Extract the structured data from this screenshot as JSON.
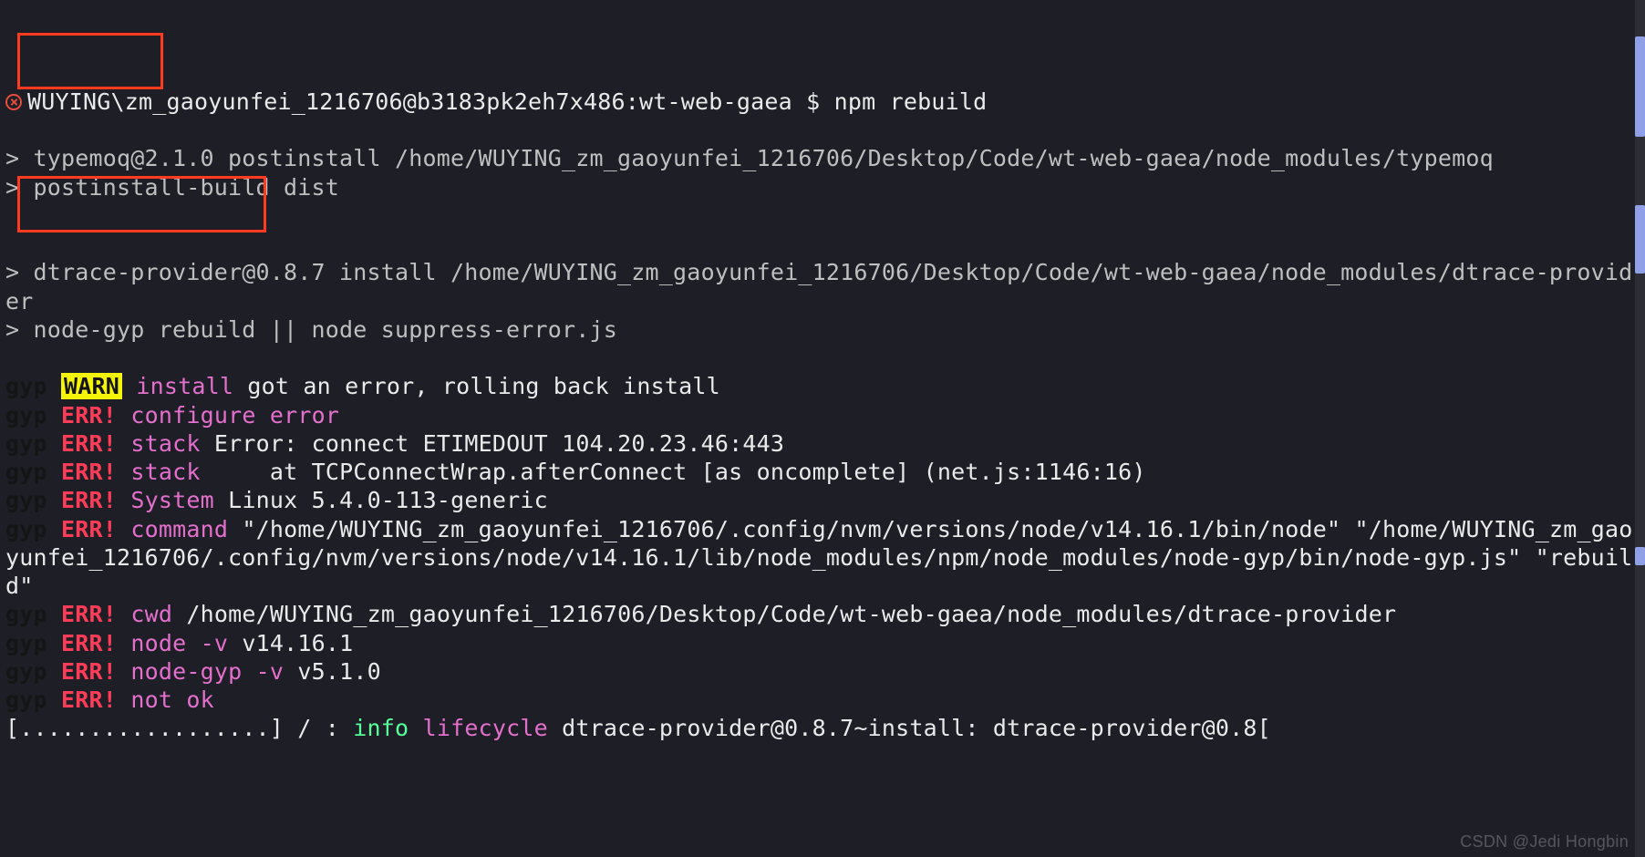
{
  "prompt": {
    "user_host": "WUYING\\zm_gaoyunfei_1216706@b3183pk2eh7x486:wt-web-gaea $ ",
    "command": "npm rebuild"
  },
  "lines": {
    "typemoq1": "> typemoq@2.1.0 postinstall /home/WUYING_zm_gaoyunfei_1216706/Desktop/Code/wt-web-gaea/node_modules/typemoq",
    "typemoq2": "> postinstall-build dist",
    "dtrace1": "> dtrace-provider@0.8.7 install /home/WUYING_zm_gaoyunfei_1216706/Desktop/Code/wt-web-gaea/node_modules/dtrace-provider",
    "dtrace2": "> node-gyp rebuild || node suppress-error.js"
  },
  "gyp": {
    "tag": "gyp",
    "warn": "WARN",
    "err": "ERR!",
    "warn_install": "install",
    "warn_msg": "got an error, rolling back install",
    "cfg_kw": "configure error",
    "stack_kw": "stack",
    "stack_msg1": "Error: connect ETIMEDOUT 104.20.23.46:443",
    "stack_msg2": "    at TCPConnectWrap.afterConnect [as oncomplete] (net.js:1146:16)",
    "system_kw": "System",
    "system_msg": "Linux 5.4.0-113-generic",
    "command_kw": "command",
    "command_msg": "\"/home/WUYING_zm_gaoyunfei_1216706/.config/nvm/versions/node/v14.16.1/bin/node\" \"/home/WUYING_zm_gaoyunfei_1216706/.config/nvm/versions/node/v14.16.1/lib/node_modules/npm/node_modules/node-gyp/bin/node-gyp.js\" \"rebuild\"",
    "cwd_kw": "cwd",
    "cwd_msg": "/home/WUYING_zm_gaoyunfei_1216706/Desktop/Code/wt-web-gaea/node_modules/dtrace-provider",
    "nodev_kw": "node -v",
    "nodev_msg": "v14.16.1",
    "gypv_kw": "node-gyp -v",
    "gypv_msg": "v5.1.0",
    "notok_kw": "not ok"
  },
  "progress": {
    "bar": "[..................]",
    "spinner": " / : ",
    "info": "info",
    "lifecycle": "lifecycle",
    "tail": "dtrace-provider@0.8.7~install: dtrace-provider@0.8["
  },
  "watermark": "CSDN @Jedi Hongbin"
}
